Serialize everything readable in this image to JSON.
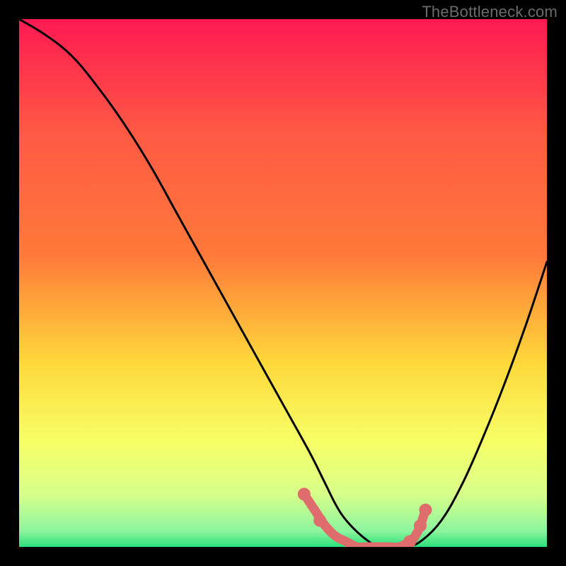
{
  "watermark": "TheBottleneck.com",
  "chart_data": {
    "type": "line",
    "title": "",
    "xlabel": "",
    "ylabel": "",
    "xlim": [
      0,
      100
    ],
    "ylim": [
      0,
      100
    ],
    "grid": false,
    "legend": false,
    "background_gradient": {
      "top": "#ff1a52",
      "upper_mid": "#ff7a3a",
      "mid": "#ffd83a",
      "lower_mid": "#f7ff66",
      "near_bottom": "#d8ff8a",
      "bottom": "#29e07a"
    },
    "series": [
      {
        "name": "bottleneck-curve",
        "stroke": "#000000",
        "x": [
          0,
          5,
          10,
          15,
          20,
          25,
          30,
          35,
          40,
          45,
          50,
          55,
          58,
          60,
          62,
          65,
          68,
          70,
          73,
          76,
          80,
          84,
          88,
          92,
          96,
          100
        ],
        "y": [
          100,
          97,
          93,
          87,
          80,
          72,
          63,
          54,
          45,
          36,
          27,
          18,
          12,
          8,
          5,
          2,
          0,
          0,
          0,
          1,
          5,
          12,
          21,
          31,
          42,
          54
        ]
      },
      {
        "name": "optimal-range-marker",
        "stroke": "#e06d6d",
        "x": [
          54,
          56,
          58,
          60,
          62,
          64,
          66,
          68,
          70,
          72,
          74,
          75,
          76,
          77
        ],
        "y": [
          10,
          7,
          4,
          2,
          1,
          0,
          0,
          0,
          0,
          0,
          1,
          2,
          4,
          7
        ]
      }
    ],
    "markers": [
      {
        "x": 54,
        "y": 10,
        "color": "#e06d6d"
      },
      {
        "x": 57,
        "y": 5,
        "color": "#e06d6d"
      },
      {
        "x": 74,
        "y": 1,
        "color": "#e06d6d"
      },
      {
        "x": 76,
        "y": 4,
        "color": "#e06d6d"
      },
      {
        "x": 77,
        "y": 7,
        "color": "#e06d6d"
      }
    ]
  }
}
